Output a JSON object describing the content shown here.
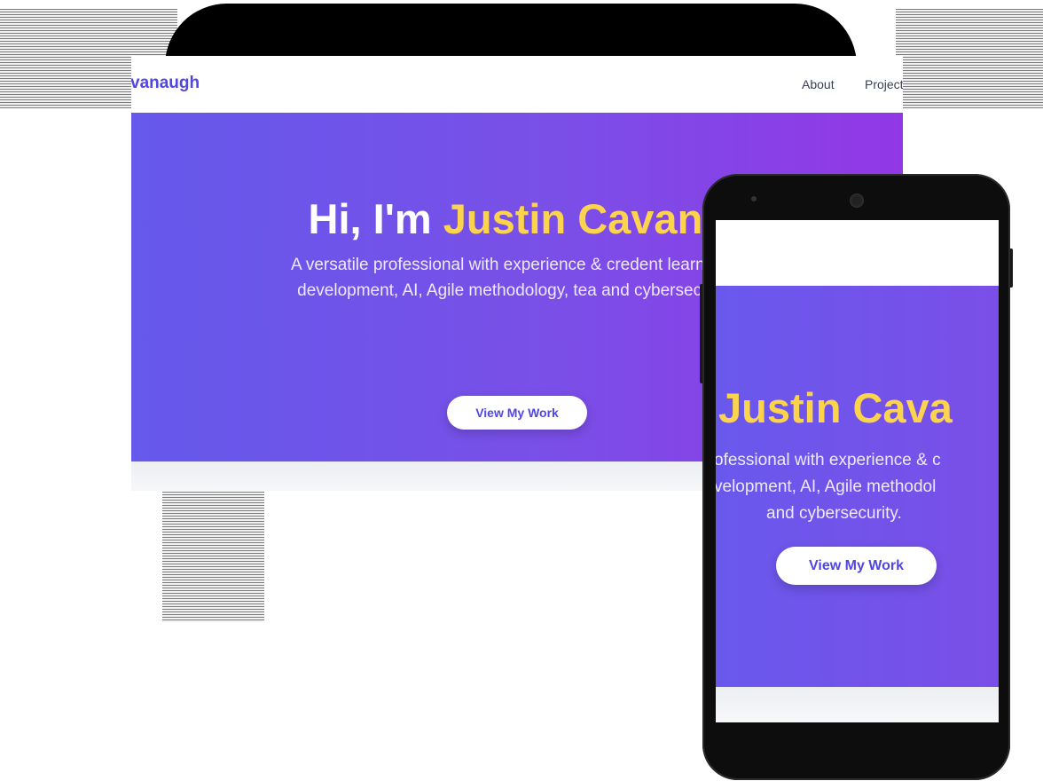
{
  "desktop": {
    "brand": "vanaugh",
    "nav": {
      "about": "About",
      "projects": "Project"
    },
    "hero": {
      "greeting": "Hi, I'm ",
      "name": "Justin Cavana",
      "subtitle": "A versatile professional with experience & credent learning & development, AI, Agile methodology, tea and cybersecurity.",
      "cta": "View My Work"
    }
  },
  "mobile": {
    "hero": {
      "name": "Justin Cava",
      "subtitle_lines": [
        "ofessional with experience & c",
        "velopment, AI, Agile methodol",
        "and cybersecurity."
      ],
      "cta": "View My Work"
    }
  },
  "colors": {
    "accent": "#4f46e5",
    "highlight": "#fcd34d",
    "gradient_start": "#6559eb",
    "gradient_end": "#9237e6"
  }
}
